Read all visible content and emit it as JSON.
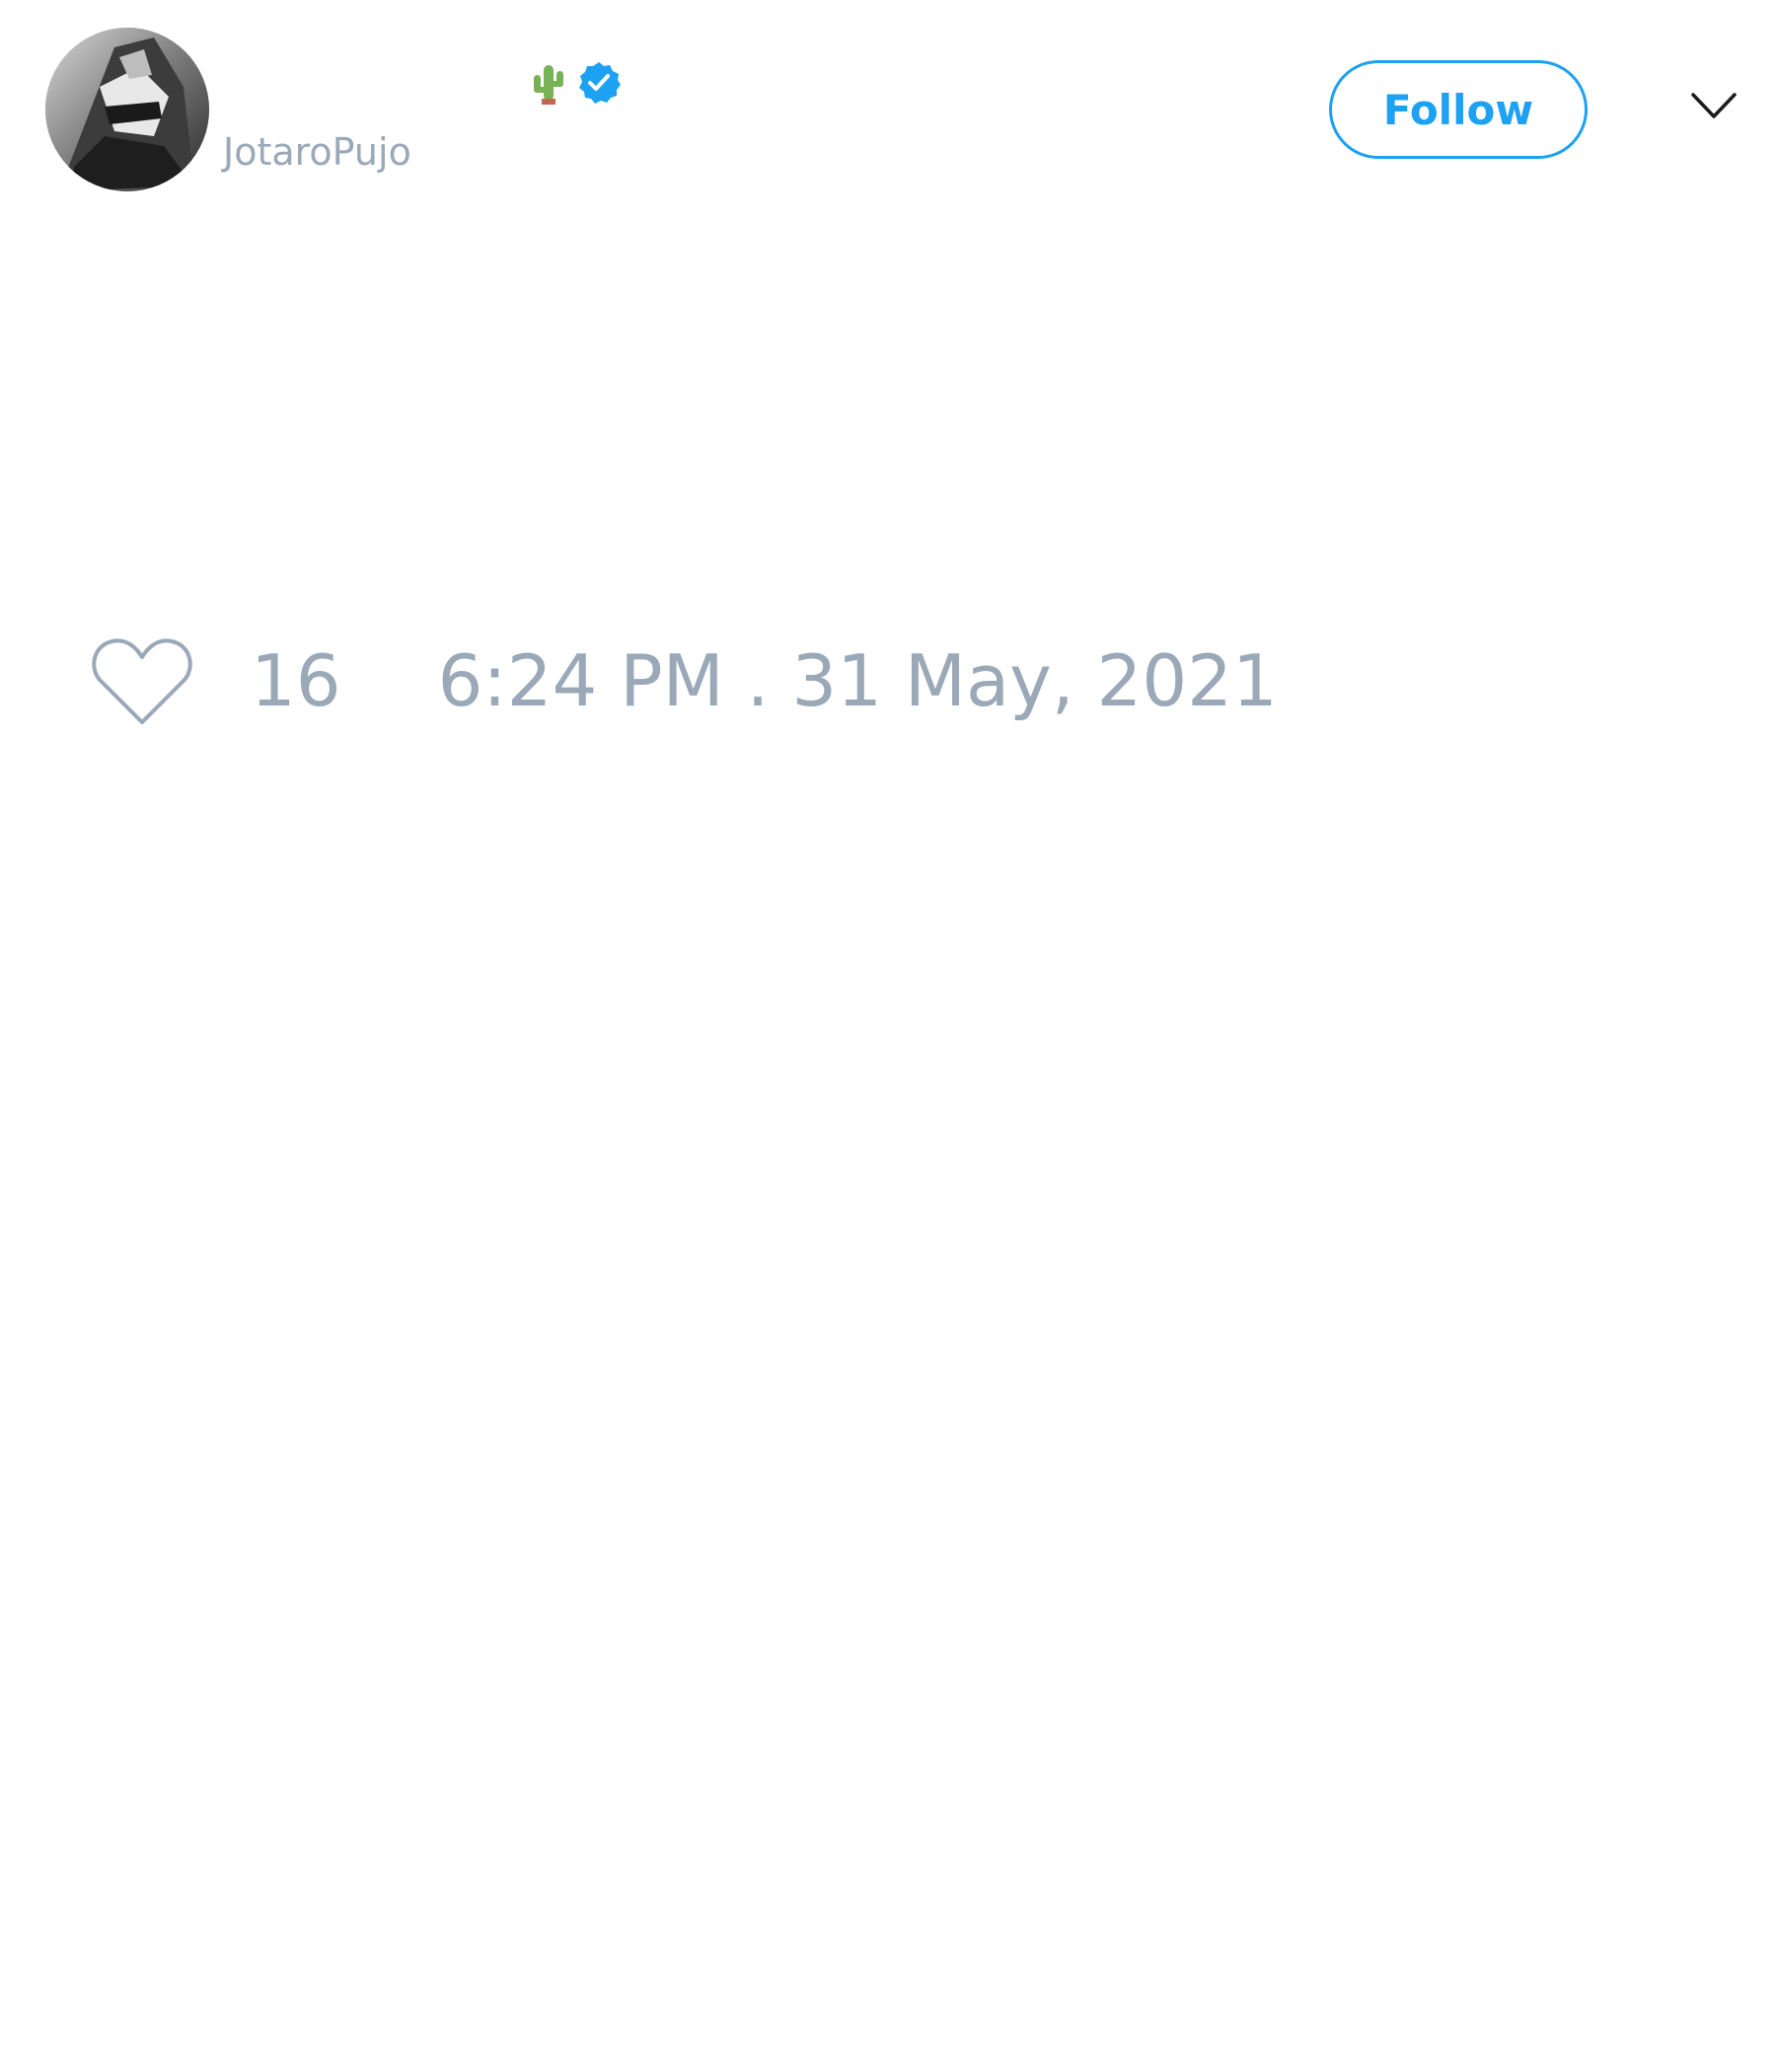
{
  "author": {
    "handle": "JotaroPujo",
    "display_name_emoji_icon": "cactus-icon",
    "verified_icon": "verified-badge-icon"
  },
  "header": {
    "follow_label": "Follow",
    "menu_icon": "chevron-down-icon"
  },
  "footer": {
    "like_icon": "heart-icon",
    "like_count": "16",
    "timestamp": "6:24 PM . 31 May, 2021"
  },
  "colors": {
    "accent": "#1da1f2",
    "muted_text": "#9aa8b8",
    "background": "#ffffff"
  }
}
